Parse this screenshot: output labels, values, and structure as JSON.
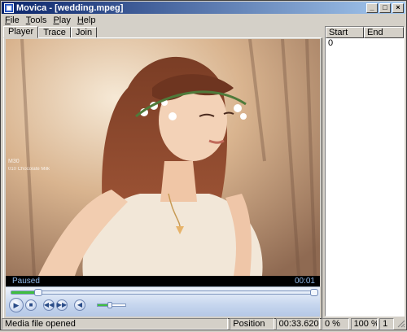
{
  "window": {
    "title": "Movica - [wedding.mpeg]",
    "app_icon": "film-icon"
  },
  "title_buttons": {
    "minimize": "_",
    "maximize": "□",
    "close": "×"
  },
  "menu": [
    {
      "label_u": "F",
      "label_rest": "ile"
    },
    {
      "label_u": "T",
      "label_rest": "ools"
    },
    {
      "label_u": "P",
      "label_rest": "lay"
    },
    {
      "label_u": "H",
      "label_rest": "elp"
    }
  ],
  "tabs": [
    {
      "label": "Player",
      "active": true
    },
    {
      "label": "Trace",
      "active": false
    },
    {
      "label": "Join",
      "active": false
    }
  ],
  "player": {
    "state": "Paused",
    "time": "00:01",
    "seek_progress": 0.09,
    "volume_level": 0.45,
    "video_watermark_line1": "M30",
    "video_watermark_line2": "010 Chocolate Milk"
  },
  "controls": {
    "play_icon": "play-icon",
    "stop_icon": "stop-icon",
    "prev_icon": "previous-icon",
    "next_icon": "next-icon",
    "mute_icon": "speaker-icon"
  },
  "list": {
    "columns": [
      "Start",
      "End"
    ],
    "rows": [
      [
        "0",
        ""
      ]
    ]
  },
  "statusbar": {
    "message": "Media file opened",
    "position_label": "Position",
    "position_value": "00:33.620",
    "percent": "0 %",
    "zoom": "100 %",
    "count": "1"
  },
  "colors": {
    "titlebar_start": "#0a246a",
    "titlebar_end": "#a6caf0",
    "seek_fill": "#3fbf3f",
    "face": "#d4d0c8"
  }
}
